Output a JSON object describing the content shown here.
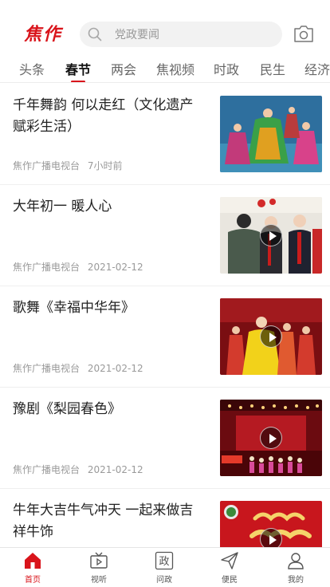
{
  "header": {
    "logo_text": "焦作",
    "search_placeholder": "党政要闻"
  },
  "tabs": [
    {
      "label": "头条"
    },
    {
      "label": "春节",
      "active": true
    },
    {
      "label": "两会"
    },
    {
      "label": "焦视频"
    },
    {
      "label": "时政"
    },
    {
      "label": "民生"
    },
    {
      "label": "经济"
    }
  ],
  "feed": [
    {
      "title": "千年舞韵 何以走红（文化遗产赋彩生活）",
      "source": "焦作广播电视台",
      "time": "7小时前",
      "has_video": false
    },
    {
      "title": "大年初一 暖人心",
      "source": "焦作广播电视台",
      "time": "2021-02-12",
      "has_video": true
    },
    {
      "title": "歌舞《幸福中华年》",
      "source": "焦作广播电视台",
      "time": "2021-02-12",
      "has_video": true
    },
    {
      "title": "豫剧《梨园春色》",
      "source": "焦作广播电视台",
      "time": "2021-02-12",
      "has_video": true
    },
    {
      "title": "牛年大吉牛气冲天 一起来做吉祥牛饰",
      "source": "",
      "time": "",
      "has_video": true
    }
  ],
  "bottom_nav": [
    {
      "label": "首页",
      "icon": "home-icon",
      "active": true
    },
    {
      "label": "视听",
      "icon": "tv-icon"
    },
    {
      "label": "问政",
      "icon": "zheng-icon",
      "glyph": "政"
    },
    {
      "label": "便民",
      "icon": "paper-plane-icon"
    },
    {
      "label": "我的",
      "icon": "user-icon"
    }
  ],
  "colors": {
    "accent": "#d9141b",
    "muted": "#9a9a9a"
  }
}
